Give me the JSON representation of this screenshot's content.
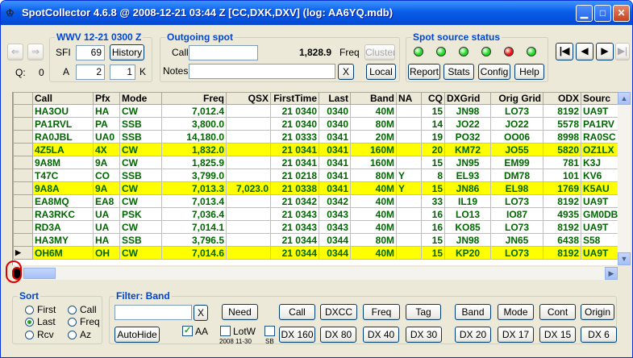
{
  "window": {
    "title": "SpotCollector 4.6.8 @ 2008-12-21  03:44 Z [CC,DXK,DXV] (log: AA6YQ.mdb)"
  },
  "wwv": {
    "title": "WWV 12-21 0300 Z",
    "sfi_label": "SFI",
    "sfi_value": "69",
    "a_label": "A",
    "a_value": "2",
    "k_label": "K",
    "k_value": "1",
    "history_label": "History"
  },
  "q": {
    "label": "Q:",
    "value": "0"
  },
  "outgoing": {
    "title": "Outgoing spot",
    "call_label": "Call",
    "call_value": "",
    "freq_value": "1,828.9",
    "freq_label": "Freq",
    "cluster_label": "Cluster",
    "notes_label": "Notes",
    "notes_value": "",
    "clear_label": "X",
    "local_label": "Local"
  },
  "status": {
    "title": "Spot source status",
    "leds": [
      {
        "color": "#22dd22"
      },
      {
        "color": "#22dd22"
      },
      {
        "color": "#22dd22"
      },
      {
        "color": "#22dd22"
      },
      {
        "color": "#ee1111"
      },
      {
        "color": "#22dd22"
      }
    ],
    "buttons": [
      "Report",
      "Stats",
      "Config",
      "Help"
    ]
  },
  "nav": {
    "first": "|◀",
    "prev": "◀",
    "next": "▶",
    "last": "▶|"
  },
  "table": {
    "columns": [
      "Call",
      "Pfx",
      "Mode",
      "Freq",
      "QSX",
      "FirstTime",
      "Last",
      "Band",
      "NA",
      "CQ",
      "DXGrid",
      "Orig Grid",
      "ODX",
      "Sourc"
    ],
    "rows": [
      {
        "hl": false,
        "cur": false,
        "cells": [
          "HA3OU",
          "HA",
          "CW",
          "7,012.4",
          "",
          "21 0340",
          "0340",
          "40M",
          "",
          "15",
          "JN98",
          "LO73",
          "8192",
          "UA9T"
        ]
      },
      {
        "hl": false,
        "cur": false,
        "cells": [
          "PA1RVL",
          "PA",
          "SSB",
          "3,800.0",
          "",
          "21 0340",
          "0340",
          "80M",
          "",
          "14",
          "JO22",
          "JO22",
          "5578",
          "PA1RV"
        ]
      },
      {
        "hl": false,
        "cur": false,
        "cells": [
          "RA0JBL",
          "UA0",
          "SSB",
          "14,180.0",
          "",
          "21 0333",
          "0341",
          "20M",
          "",
          "19",
          "PO32",
          "OO06",
          "8998",
          "RA0SC"
        ]
      },
      {
        "hl": true,
        "cur": false,
        "cells": [
          "4Z5LA",
          "4X",
          "CW",
          "1,832.0",
          "",
          "21 0341",
          "0341",
          "160M",
          "",
          "20",
          "KM72",
          "JO55",
          "5820",
          "OZ1LX"
        ]
      },
      {
        "hl": false,
        "cur": false,
        "cells": [
          "9A8M",
          "9A",
          "CW",
          "1,825.9",
          "",
          "21 0341",
          "0341",
          "160M",
          "",
          "15",
          "JN95",
          "EM99",
          "781",
          "K3J"
        ]
      },
      {
        "hl": false,
        "cur": false,
        "cells": [
          "T47C",
          "CO",
          "SSB",
          "3,799.0",
          "",
          "21 0218",
          "0341",
          "80M",
          "Y",
          "8",
          "EL93",
          "DM78",
          "101",
          "KV6"
        ]
      },
      {
        "hl": true,
        "cur": false,
        "cells": [
          "9A8A",
          "9A",
          "CW",
          "7,013.3",
          "7,023.0",
          "21 0338",
          "0341",
          "40M",
          "Y",
          "15",
          "JN86",
          "EL98",
          "1769",
          "K5AU"
        ]
      },
      {
        "hl": false,
        "cur": false,
        "cells": [
          "EA8MQ",
          "EA8",
          "CW",
          "7,013.4",
          "",
          "21 0342",
          "0342",
          "40M",
          "",
          "33",
          "IL19",
          "LO73",
          "8192",
          "UA9T"
        ]
      },
      {
        "hl": false,
        "cur": false,
        "cells": [
          "RA3RKC",
          "UA",
          "PSK",
          "7,036.4",
          "",
          "21 0343",
          "0343",
          "40M",
          "",
          "16",
          "LO13",
          "IO87",
          "4935",
          "GM0DB"
        ]
      },
      {
        "hl": false,
        "cur": false,
        "cells": [
          "RD3A",
          "UA",
          "CW",
          "7,014.1",
          "",
          "21 0343",
          "0343",
          "40M",
          "",
          "16",
          "KO85",
          "LO73",
          "8192",
          "UA9T"
        ]
      },
      {
        "hl": false,
        "cur": false,
        "cells": [
          "HA3MY",
          "HA",
          "SSB",
          "3,796.5",
          "",
          "21 0344",
          "0344",
          "80M",
          "",
          "15",
          "JN98",
          "JN65",
          "6438",
          "S58"
        ]
      },
      {
        "hl": true,
        "cur": true,
        "cells": [
          "OH6M",
          "OH",
          "CW",
          "7,014.6",
          "",
          "21 0344",
          "0344",
          "40M",
          "",
          "15",
          "KP20",
          "LO73",
          "8192",
          "UA9T"
        ]
      }
    ]
  },
  "sort": {
    "title": "Sort",
    "options": [
      {
        "label": "First",
        "checked": false
      },
      {
        "label": "Call",
        "checked": false
      },
      {
        "label": "Last",
        "checked": true
      },
      {
        "label": "Freq",
        "checked": false
      },
      {
        "label": "Rcv",
        "checked": false
      },
      {
        "label": "Az",
        "checked": false
      }
    ]
  },
  "filter": {
    "title": "Filter: Band",
    "input_value": "",
    "clear_label": "X",
    "need_label": "Need",
    "autohide_label": "AutoHide",
    "aa_label": "AA",
    "aa_checked": true,
    "lotw_label": "LotW",
    "lotw_checked": false,
    "lotw_date": "2008 11-30",
    "sb_label": "SB",
    "row1": [
      "Call",
      "DXCC",
      "Freq",
      "Tag",
      "Band",
      "Mode",
      "Cont",
      "Origin"
    ],
    "row2": [
      "DX 160",
      "DX 80",
      "DX 40",
      "DX 30",
      "DX 20",
      "DX 17",
      "DX 15",
      "DX 6"
    ]
  }
}
